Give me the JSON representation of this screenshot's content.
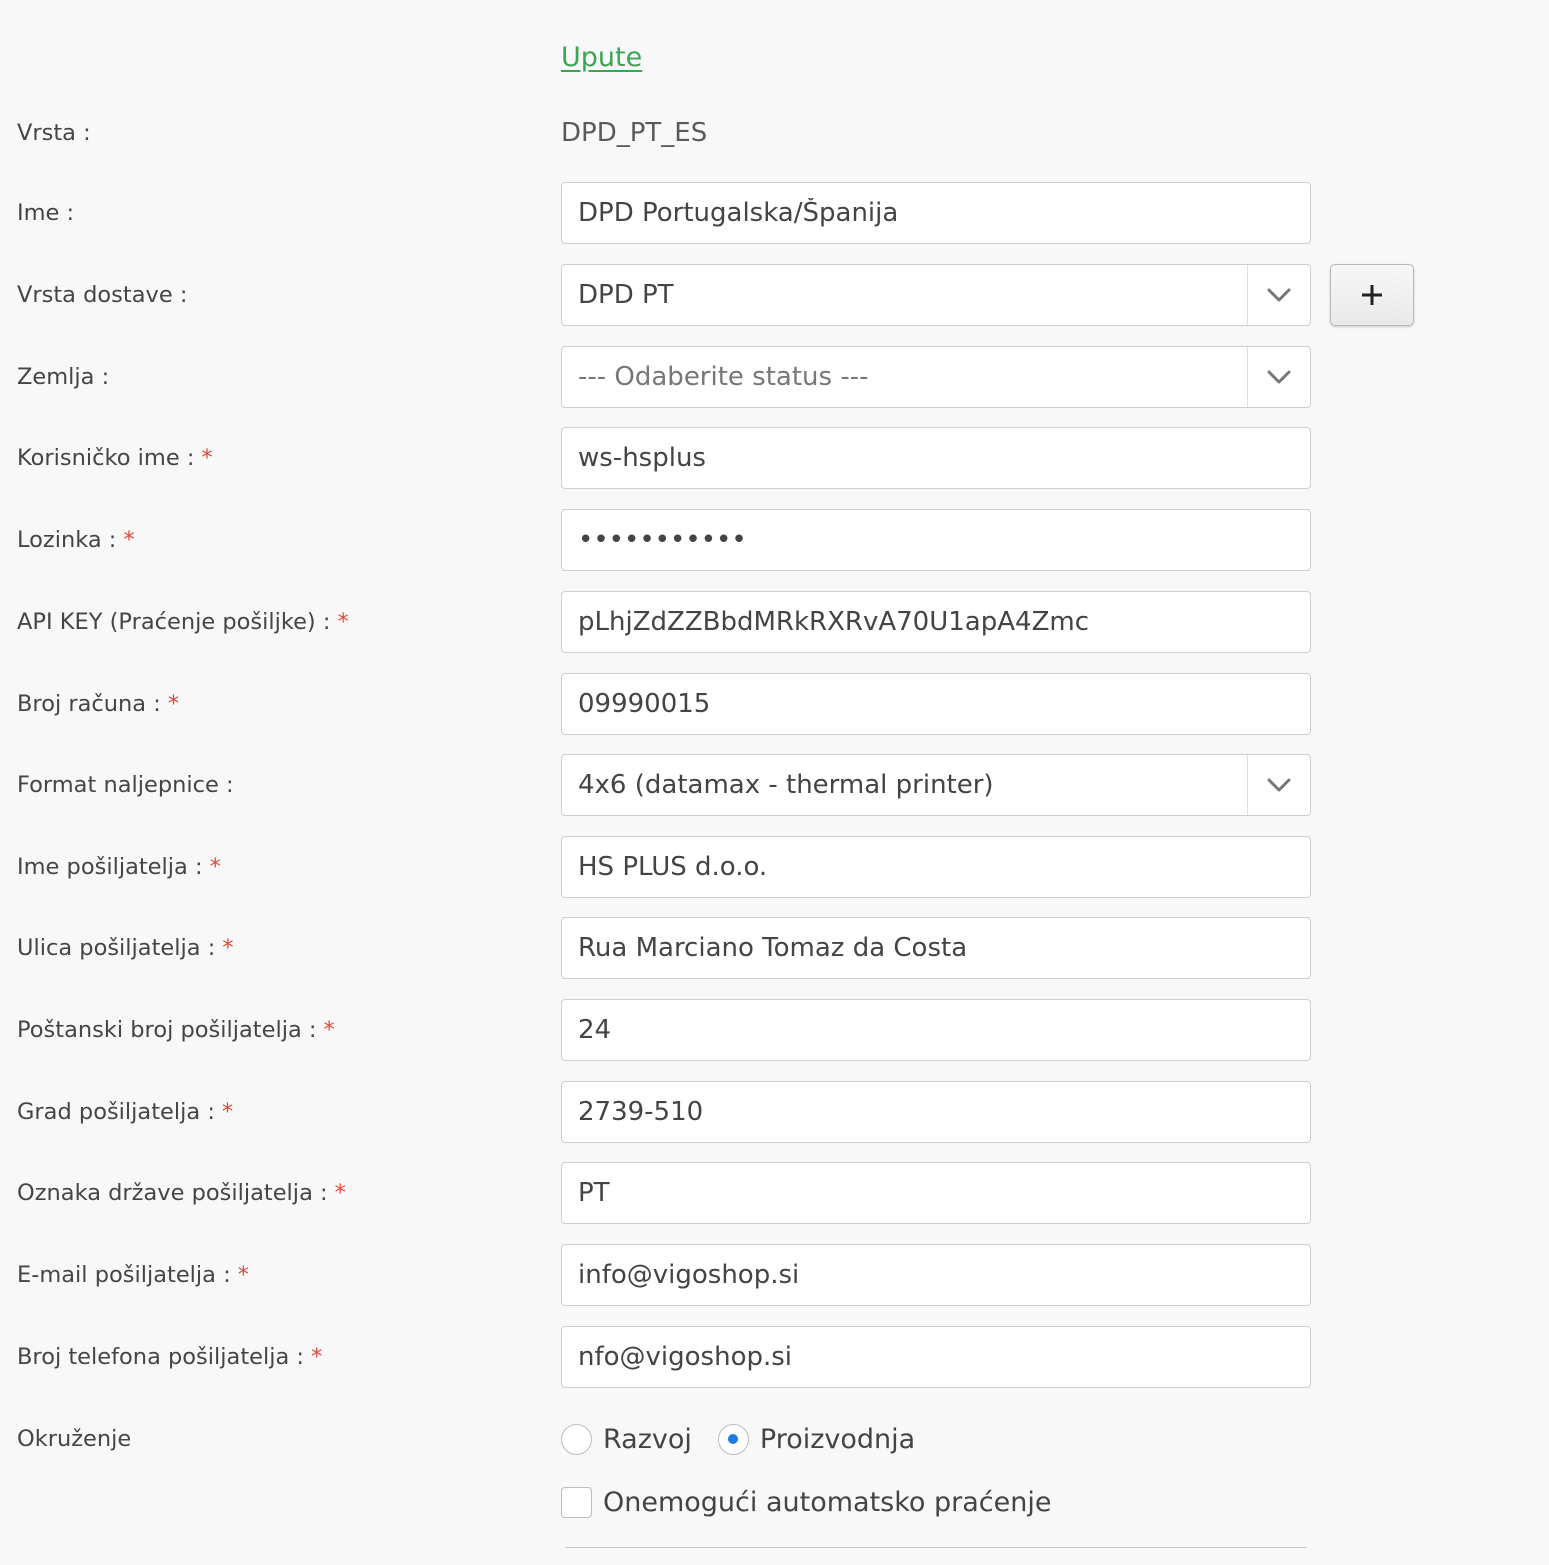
{
  "help_link": "Upute",
  "fields": {
    "vrsta": {
      "label": "Vrsta :",
      "value": "DPD_PT_ES"
    },
    "ime": {
      "label": "Ime :",
      "value": "DPD Portugalska/Španija"
    },
    "vrsta_dostave": {
      "label": "Vrsta dostave :",
      "value": "DPD PT",
      "add_button": "+"
    },
    "zemlja": {
      "label": "Zemlja :",
      "placeholder": "--- Odaberite status ---"
    },
    "korisnicko_ime": {
      "label": "Korisničko ime :",
      "value": "ws-hsplus"
    },
    "lozinka": {
      "label": "Lozinka :",
      "value": "•••••••••••"
    },
    "api_key": {
      "label": "API KEY (Praćenje pošiljke) :",
      "value": "pLhjZdZZBbdMRkRXRvA70U1apA4Zmc"
    },
    "broj_racuna": {
      "label": "Broj računa :",
      "value": "09990015"
    },
    "format_naljepnice": {
      "label": "Format naljepnice :",
      "value": "4x6 (datamax - thermal printer)"
    },
    "ime_posiljatelja": {
      "label": "Ime pošiljatelja :",
      "value": "HS PLUS d.o.o."
    },
    "ulica_posiljatelja": {
      "label": "Ulica pošiljatelja :",
      "value": "Rua Marciano Tomaz da Costa"
    },
    "postanski_broj": {
      "label": "Poštanski broj pošiljatelja :",
      "value": "24"
    },
    "grad_posiljatelja": {
      "label": "Grad pošiljatelja :",
      "value": "2739-510"
    },
    "oznaka_drzave": {
      "label": "Oznaka države pošiljatelja :",
      "value": "PT"
    },
    "email_posiljatelja": {
      "label": "E-mail pošiljatelja :",
      "value": "info@vigoshop.si"
    },
    "telefon_posiljatelja": {
      "label": "Broj telefona pošiljatelja :",
      "value": "nfo@vigoshop.si"
    }
  },
  "required_marker": "*",
  "okruzenje": {
    "label": "Okruženje",
    "options": [
      "Razvoj",
      "Proizvodnja"
    ],
    "selected": "Proizvodnja"
  },
  "disable_tracking": {
    "label": "Onemogući automatsko praćenje",
    "checked": false
  },
  "colors": {
    "link": "#3aa655",
    "required": "#e04a3b",
    "radio_selected": "#1a7ce0"
  },
  "icons": {
    "select_caret": "chevron-down-icon",
    "add": "plus-icon"
  }
}
